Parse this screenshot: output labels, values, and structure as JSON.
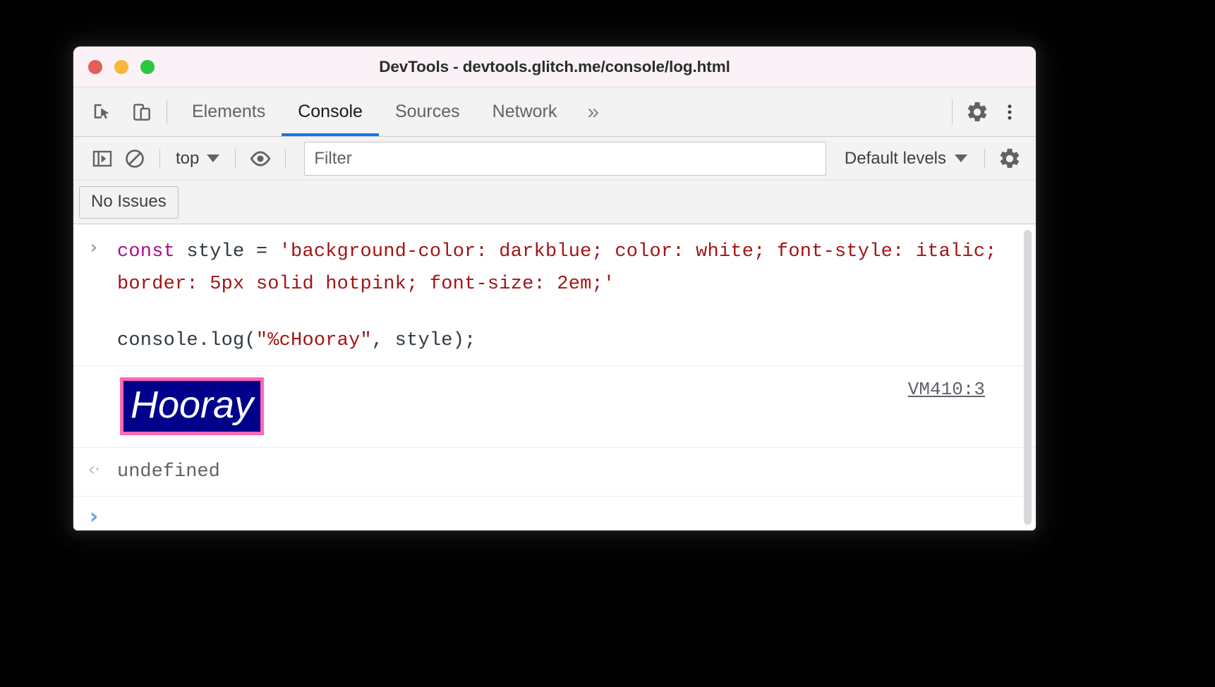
{
  "window": {
    "title": "DevTools - devtools.glitch.me/console/log.html",
    "traffic_lights": [
      {
        "name": "close",
        "color": "#e15f58"
      },
      {
        "name": "minimize",
        "color": "#f6b73c"
      },
      {
        "name": "zoom",
        "color": "#29c83f"
      }
    ]
  },
  "tabstrip": {
    "inspect_icon": "inspect-element-icon",
    "device_icon": "device-toolbar-icon",
    "tabs": [
      {
        "label": "Elements",
        "active": false
      },
      {
        "label": "Console",
        "active": true
      },
      {
        "label": "Sources",
        "active": false
      },
      {
        "label": "Network",
        "active": false
      }
    ],
    "more_tabs_label": "»",
    "settings_icon": "gear-icon",
    "more_options_icon": "kebab-menu-icon",
    "active_tab_underline_color": "#1a73e8"
  },
  "console_toolbar": {
    "sidebar_toggle_icon": "console-sidebar-icon",
    "clear_console_icon": "clear-console-icon",
    "context_selector": "top",
    "live_expression_icon": "eye-icon",
    "filter_placeholder": "Filter",
    "filter_value": "",
    "levels_selector": "Default levels",
    "console_settings_icon": "gear-icon"
  },
  "issues_bar": {
    "no_issues_label": "No Issues"
  },
  "console": {
    "command": {
      "prompt_glyph": "›",
      "line1": [
        {
          "text": "const ",
          "kind": "keyword"
        },
        {
          "text": "style = ",
          "kind": "plain"
        },
        {
          "text": "'background-color: darkblue; color: white; font-style: italic; border: 5px solid hotpink; font-size: 2em;'",
          "kind": "string"
        }
      ],
      "line2": [
        {
          "text": "console.log(",
          "kind": "plain"
        },
        {
          "text": "\"%cHooray\"",
          "kind": "string"
        },
        {
          "text": ", style);",
          "kind": "plain"
        }
      ]
    },
    "output": {
      "text": "Hooray",
      "background_color": "#00008b",
      "text_color": "#ffffff",
      "font_style": "italic",
      "border": "5px solid hotpink",
      "border_color": "#ff69b4",
      "font_size": "2em",
      "source_link": "VM410:3"
    },
    "result": {
      "glyph": "‹·",
      "value": "undefined"
    },
    "prompt": {
      "glyph": "›"
    }
  }
}
